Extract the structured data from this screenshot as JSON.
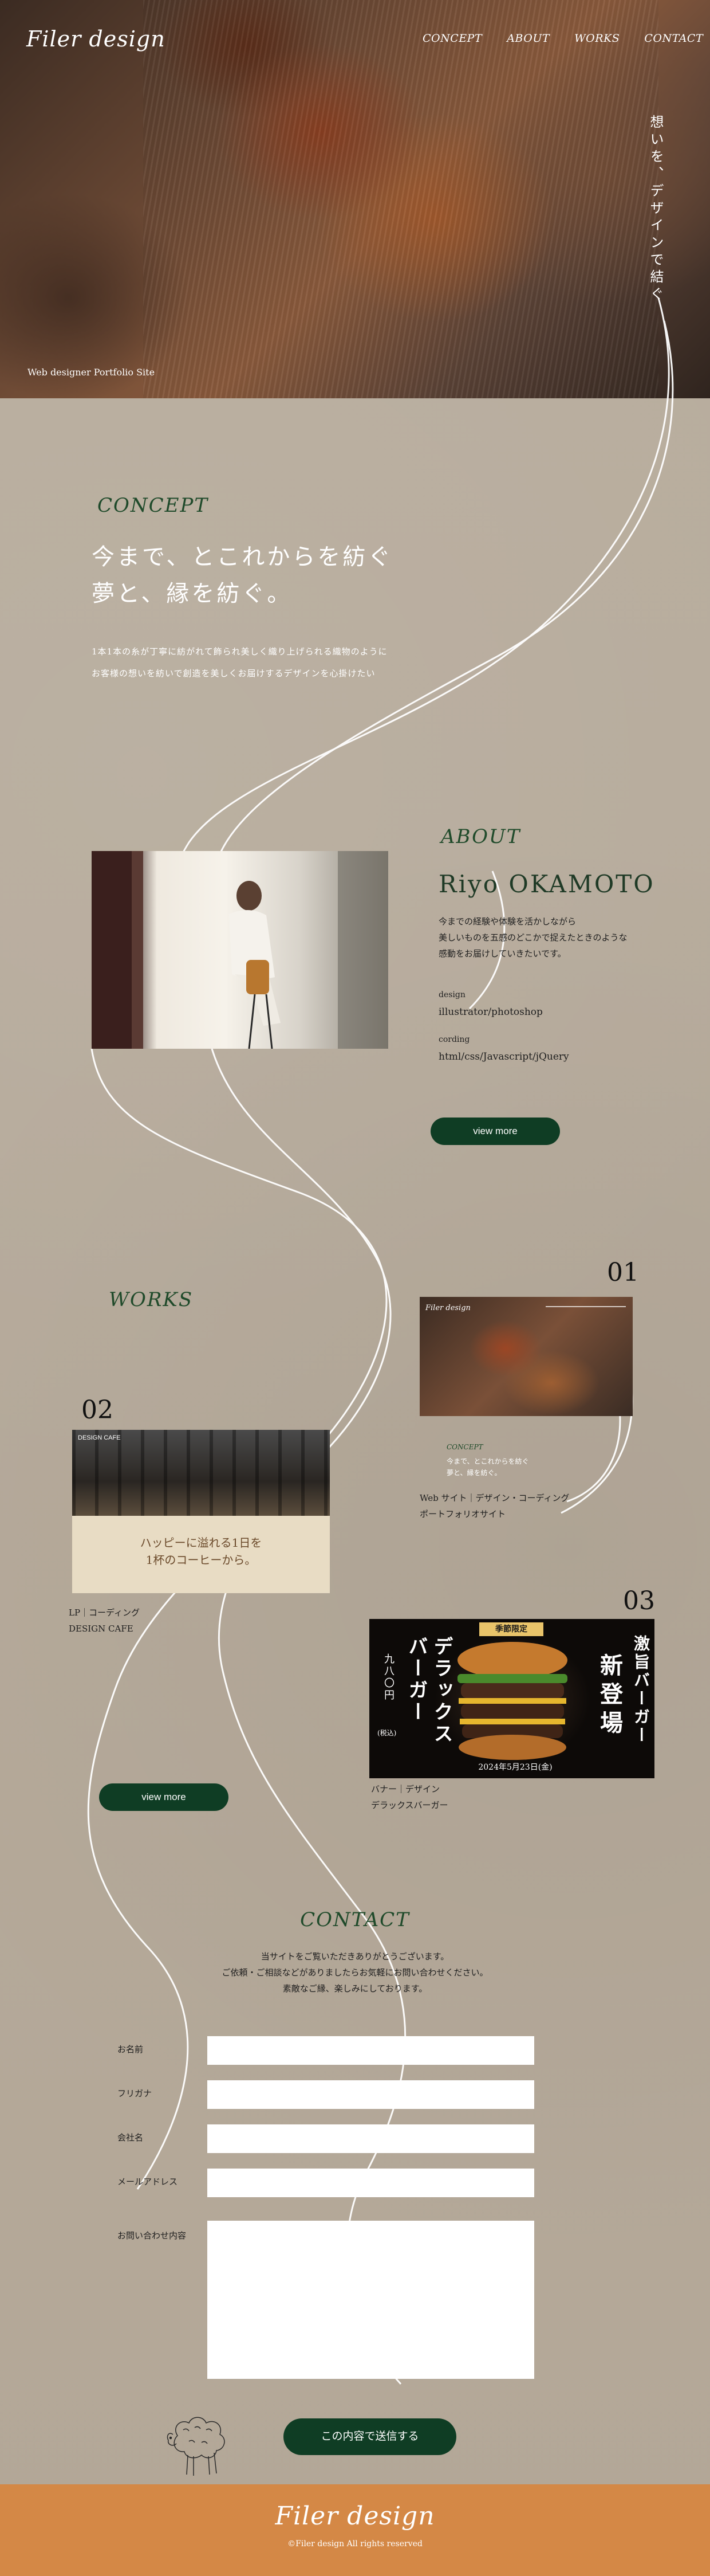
{
  "header": {
    "logo": "Filer design",
    "nav": [
      "CONCEPT",
      "ABOUT",
      "WORKS",
      "CONTACT"
    ],
    "vertical_tagline": "想いを、デザインで結ぐ",
    "hero_subtitle": "Web designer Portfolio Site"
  },
  "concept": {
    "heading": "CONCEPT",
    "lead_line1": "今まで、とこれからを紡ぐ",
    "lead_line2": "夢と、縁を紡ぐ。",
    "body_line1": "1本1本の糸が丁寧に紡がれて飾られ美しく織り上げられる織物のように",
    "body_line2": "お客様の想いを紡いで創造を美しくお届けするデザインを心掛けたい"
  },
  "about": {
    "heading": "ABOUT",
    "name": "Riyo OKAMOTO",
    "bio_line1": "今までの経験や体験を活かしながら",
    "bio_line2": "美しいものを五感のどこかで捉えたときのような",
    "bio_line3": "感動をお届けしていきたいです。",
    "design_label": "design",
    "design_tools": "illustrator/photoshop",
    "coding_label": "cording",
    "coding_tools": "html/css/Javascript/jQuery",
    "button": "view more"
  },
  "works": {
    "heading": "WORKS",
    "items": [
      {
        "number": "01",
        "caption_line1": "Web サイト｜デザイン・コーディング",
        "caption_line2": "ポートフォリオサイト",
        "thumb_logo": "Filer design",
        "thumb_concept": "CONCEPT",
        "thumb_lead1": "今まで、とこれからを紡ぐ",
        "thumb_lead2": "夢と、縁を紡ぐ。"
      },
      {
        "number": "02",
        "caption_line1": "LP｜コーディング",
        "caption_line2": "DESIGN CAFE",
        "thumb_logo": "DESIGN CAFE",
        "thumb_headline1": "ハッピーに溢れる1日を",
        "thumb_headline2": "1杯のコーヒーから。"
      },
      {
        "number": "03",
        "caption_line1": "バナー｜デザイン",
        "caption_line2": "デラックスバーガー",
        "thumb_badge": "季節限定",
        "thumb_title1": "激旨バーガー",
        "thumb_title2": "新登場",
        "thumb_title3": "デラックスバーガー",
        "thumb_price": "九八〇円",
        "thumb_tax": "(税込)",
        "thumb_date": "2024年5月23日(金)"
      }
    ],
    "button": "view more"
  },
  "contact": {
    "heading": "CONTACT",
    "intro_line1": "当サイトをご覧いただきありがとうございます。",
    "intro_line2": "ご依頼・ご相談などがありましたらお気軽にお問い合わせください。",
    "intro_line3": "素敵なご縁、楽しみにしております。",
    "fields": {
      "name": "お名前",
      "furigana": "フリガナ",
      "company": "会社名",
      "email": "メールアドレス",
      "message": "お問い合わせ内容"
    },
    "submit": "この内容で送信する"
  },
  "footer": {
    "logo": "Filer design",
    "copyright": "©Filer design All rights reserved"
  },
  "colors": {
    "background": "#b6ab9d",
    "accent_green": "#0f3d24",
    "footer_orange": "#d48846"
  }
}
